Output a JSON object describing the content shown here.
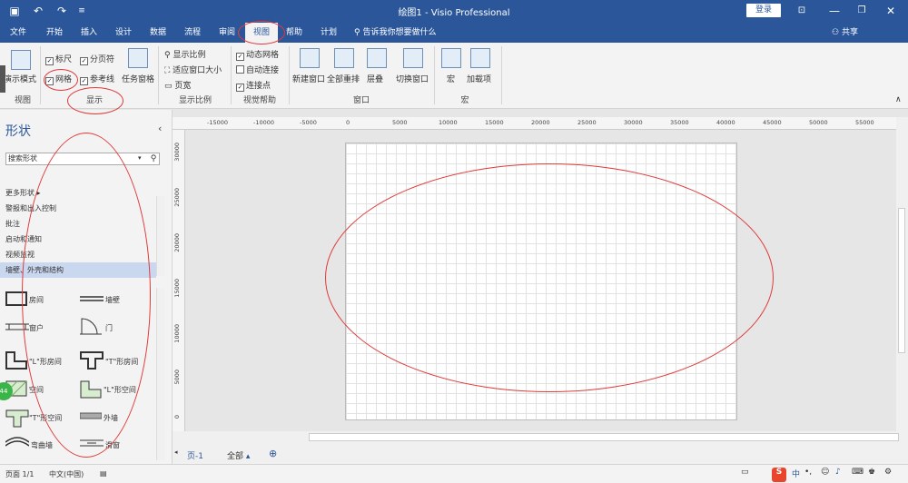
{
  "titlebar": {
    "title": "绘图1 - Visio Professional",
    "login": "登录",
    "icons": [
      "save-icon",
      "undo-icon",
      "redo-icon",
      "customize-icon"
    ]
  },
  "menubar": {
    "tabs": [
      "文件",
      "开始",
      "插入",
      "设计",
      "数据",
      "流程",
      "审阅",
      "视图",
      "帮助",
      "计划"
    ],
    "active_tab": "视图",
    "tellme": "告诉我你想要做什么",
    "share": "共享"
  },
  "ribbon": {
    "view_group": {
      "button": "演示模式",
      "label": "视图"
    },
    "show_group": {
      "ruler": "标尺",
      "pagebreak": "分页符",
      "grid": "网格",
      "guides": "参考线",
      "task_panes": "任务窗格",
      "label": "显示"
    },
    "zoom_group": {
      "zoom": "显示比例",
      "fit_window": "适应窗口大小",
      "page_width": "页宽",
      "label": "显示比例"
    },
    "visual_aids_group": {
      "dynamic_grid": "动态网格",
      "auto_connect": "自动连接",
      "connection_points": "连接点",
      "label": "视觉帮助"
    },
    "window_group": {
      "new_window": "新建窗口",
      "arrange_all": "全部重排",
      "cascade": "层叠",
      "switch_windows": "切换窗口",
      "label": "窗口"
    },
    "macro_group": {
      "macros": "宏",
      "addins": "加载项",
      "label": "宏"
    }
  },
  "shapes_panel": {
    "title": "形状",
    "search_placeholder": "搜索形状",
    "more_shapes": "更多形状",
    "stencils": [
      "警报和出入控制",
      "批注",
      "启动和通知",
      "视频监视",
      "墙壁、外壳和结构"
    ],
    "selected_stencil": "墙壁、外壳和结构",
    "shapes": [
      "房间",
      "墙壁",
      "窗户",
      "门",
      "\"L\"形房间",
      "\"T\"形房间",
      "空间",
      "\"L\"形空间",
      "\"T\"形空间",
      "外墙",
      "弯曲墙",
      "滑窗"
    ]
  },
  "ruler": {
    "top": [
      "-15000",
      "-10000",
      "-5000",
      "0",
      "5000",
      "10000",
      "15000",
      "20000",
      "25000",
      "30000",
      "35000",
      "40000",
      "45000",
      "50000",
      "55000"
    ],
    "left": [
      "30000",
      "25000",
      "20000",
      "15000",
      "10000",
      "5000",
      "0"
    ]
  },
  "bottom": {
    "page_tab": "页-1",
    "all_pages": "全部"
  },
  "statusbar": {
    "page": "页面 1/1",
    "language": "中文(中国)",
    "ime": "中"
  },
  "side_badge": "44"
}
